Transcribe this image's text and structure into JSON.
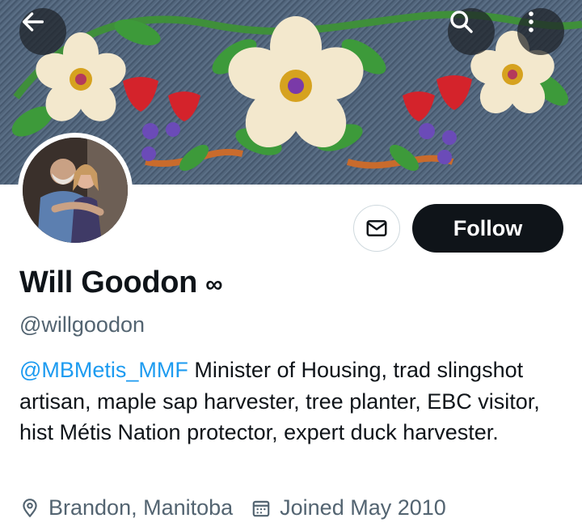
{
  "profile": {
    "display_name": "Will Goodon",
    "name_badge": "∞",
    "handle": "@willgoodon",
    "bio_mention": "@MBMetis_MMF",
    "bio_text": " Minister of Housing, trad slingshot artisan, maple sap harvester, tree planter, EBC visitor, hist Métis Nation protector, expert duck harvester.",
    "location": "Brandon, Manitoba",
    "joined": "Joined May 2010"
  },
  "actions": {
    "follow_label": "Follow"
  },
  "icons": {
    "back": "arrow-left-icon",
    "search": "search-icon",
    "more": "more-vertical-icon",
    "message": "envelope-icon",
    "location": "location-pin-icon",
    "calendar": "calendar-icon"
  },
  "colors": {
    "link": "#1d9bf0",
    "secondary_text": "#536471",
    "primary_text": "#0f1419",
    "follow_bg": "#0f1419"
  }
}
